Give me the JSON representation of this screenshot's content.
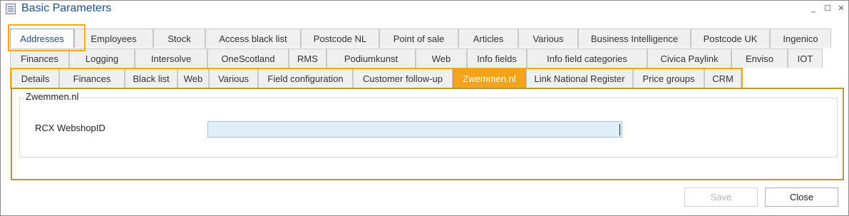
{
  "window": {
    "title": "Basic Parameters",
    "icon": "app-window-icon",
    "minimize_glyph": "_",
    "maximize_glyph": "☐",
    "close_glyph": "✕"
  },
  "tabs_row1": [
    "Addresses",
    "Employees",
    "Stock",
    "Access black list",
    "Postcode NL",
    "Point of sale",
    "Articles",
    "Various",
    "Business Intelligence",
    "Postcode UK",
    "Ingenico"
  ],
  "tabs_row2": [
    "Finances",
    "Logging",
    "Intersolve",
    "OneScotland",
    "RMS",
    "Podiumkunst",
    "Web",
    "Info fields",
    "Info field categories",
    "Civica Paylink",
    "Enviso",
    "IOT"
  ],
  "subtabs": [
    "Details",
    "Finances",
    "Black list",
    "Web",
    "Various",
    "Field configuration",
    "Customer follow-up",
    "Zwemmen.nl",
    "Link National Register",
    "Price groups",
    "CRM"
  ],
  "active_tab": "Addresses",
  "active_subtab": "Zwemmen.nl",
  "group": {
    "title": "Zwemmen.nl",
    "field_label": "RCX WebshopID",
    "field_value": ""
  },
  "footer": {
    "save_label": "Save",
    "close_label": "Close"
  },
  "colors": {
    "title": "#1f4e8c",
    "active_subtab": "#f3a41c",
    "highlight": "#f2a91f",
    "panel_border": "#b69a36",
    "input_bg": "#dff0fb"
  }
}
